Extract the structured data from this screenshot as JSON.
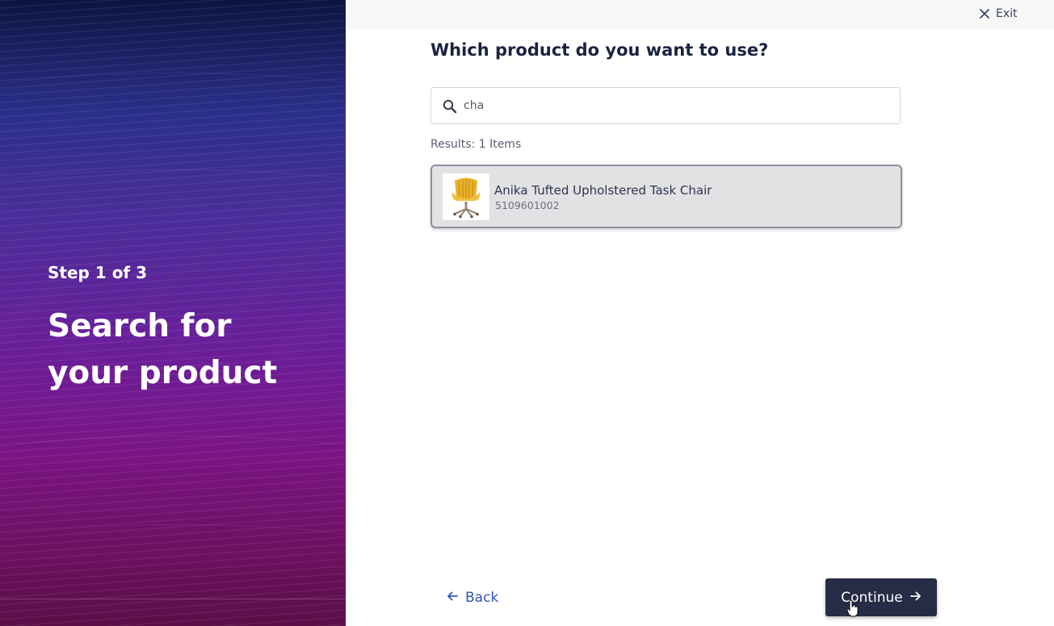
{
  "sidebar": {
    "step": "Step 1 of 3",
    "title": "Search for your product"
  },
  "header": {
    "exit_label": "Exit",
    "exit_icon": "close-icon"
  },
  "main": {
    "question": "Which product do you want to use?",
    "search": {
      "value": "cha",
      "icon": "search-icon"
    },
    "results_count": "Results: 1 Items",
    "results": [
      {
        "name": "Anika Tufted Upholstered Task Chair",
        "sku": "5109601002",
        "image_icon": "yellow-chair-image"
      }
    ]
  },
  "footer": {
    "back_label": "Back",
    "continue_label": "Continue"
  },
  "colors": {
    "primary_dark": "#262c45",
    "link_blue": "#2f56b5",
    "selected_card_bg": "#e2e2e4"
  }
}
